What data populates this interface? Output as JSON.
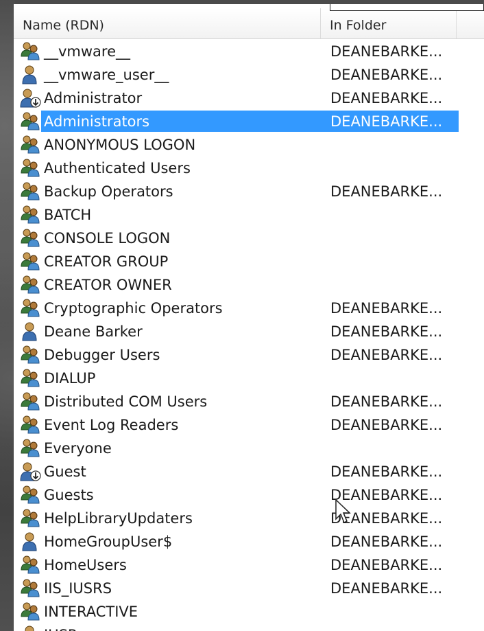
{
  "columns": {
    "name": "Name (RDN)",
    "folder": "In Folder"
  },
  "rows": [
    {
      "name": "__vmware__",
      "folder": "DEANEBARKE...",
      "icon": "group-icon"
    },
    {
      "name": "__vmware_user__",
      "folder": "DEANEBARKE...",
      "icon": "user-icon"
    },
    {
      "name": "Administrator",
      "folder": "DEANEBARKE...",
      "icon": "user-download-icon"
    },
    {
      "name": "Administrators",
      "folder": "DEANEBARKE...",
      "icon": "group-icon",
      "selected": true
    },
    {
      "name": "ANONYMOUS LOGON",
      "folder": "",
      "icon": "group-icon"
    },
    {
      "name": "Authenticated Users",
      "folder": "",
      "icon": "group-icon"
    },
    {
      "name": "Backup Operators",
      "folder": "DEANEBARKE...",
      "icon": "group-icon"
    },
    {
      "name": "BATCH",
      "folder": "",
      "icon": "group-icon"
    },
    {
      "name": "CONSOLE LOGON",
      "folder": "",
      "icon": "group-icon"
    },
    {
      "name": "CREATOR GROUP",
      "folder": "",
      "icon": "group-icon"
    },
    {
      "name": "CREATOR OWNER",
      "folder": "",
      "icon": "group-icon"
    },
    {
      "name": "Cryptographic Operators",
      "folder": "DEANEBARKE...",
      "icon": "group-icon"
    },
    {
      "name": "Deane Barker",
      "folder": "DEANEBARKE...",
      "icon": "user-icon"
    },
    {
      "name": "Debugger Users",
      "folder": "DEANEBARKE...",
      "icon": "group-icon"
    },
    {
      "name": "DIALUP",
      "folder": "",
      "icon": "group-icon"
    },
    {
      "name": "Distributed COM Users",
      "folder": "DEANEBARKE...",
      "icon": "group-icon"
    },
    {
      "name": "Event Log Readers",
      "folder": "DEANEBARKE...",
      "icon": "group-icon"
    },
    {
      "name": "Everyone",
      "folder": "",
      "icon": "group-icon"
    },
    {
      "name": "Guest",
      "folder": "DEANEBARKE...",
      "icon": "user-download-icon"
    },
    {
      "name": "Guests",
      "folder": "DEANEBARKE...",
      "icon": "group-icon"
    },
    {
      "name": "HelpLibraryUpdaters",
      "folder": "DEANEBARKE...",
      "icon": "group-icon"
    },
    {
      "name": "HomeGroupUser$",
      "folder": "DEANEBARKE...",
      "icon": "user-icon"
    },
    {
      "name": "HomeUsers",
      "folder": "DEANEBARKE...",
      "icon": "group-icon"
    },
    {
      "name": "IIS_IUSRS",
      "folder": "DEANEBARKE...",
      "icon": "group-icon"
    },
    {
      "name": "INTERACTIVE",
      "folder": "",
      "icon": "group-icon"
    },
    {
      "name": "IUSR",
      "folder": "",
      "icon": "user-icon"
    }
  ],
  "colors": {
    "selection": "#3399ff"
  }
}
